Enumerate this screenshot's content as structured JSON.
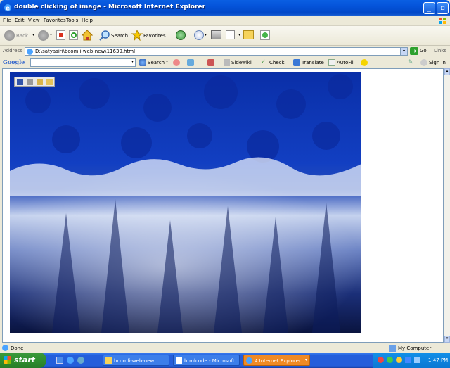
{
  "window": {
    "title": "double clicking of image - Microsoft Internet Explorer"
  },
  "menu": [
    "File",
    "Edit",
    "View",
    "Favorites",
    "Tools",
    "Help"
  ],
  "toolbar": {
    "back_label": "Back",
    "search_label": "Search",
    "favorites_label": "Favorites"
  },
  "address": {
    "label": "Address",
    "value": "D:\\satyasiri\\bcomli-web-new\\11639.html",
    "go_label": "Go",
    "links_label": "Links"
  },
  "google": {
    "logo": "Google",
    "search_label": "Search",
    "sidewiki_label": "Sidewiki",
    "check_label": "Check",
    "translate_label": "Translate",
    "autofill_label": "AutoFill",
    "signin_label": "Sign In"
  },
  "status": {
    "text": "Done",
    "zone": "My Computer"
  },
  "taskbar": {
    "start_label": "start",
    "tasks": [
      "bcomli-web-new",
      "htmlcode - Microsoft ...",
      "4 Internet Explorer"
    ],
    "clock": "1:47 PM"
  }
}
